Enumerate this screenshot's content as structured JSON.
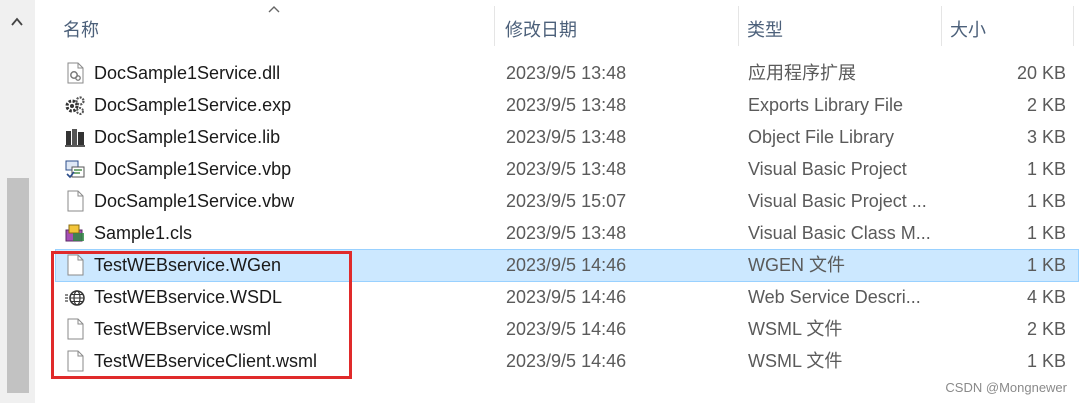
{
  "header": {
    "col_name": "名称",
    "col_date": "修改日期",
    "col_type": "类型",
    "col_size": "大小"
  },
  "files": [
    {
      "name": "DocSample1Service.dll",
      "date": "2023/9/5 13:48",
      "type": "应用程序扩展",
      "size": "20 KB",
      "icon": "dll-file-icon"
    },
    {
      "name": "DocSample1Service.exp",
      "date": "2023/9/5 13:48",
      "type": "Exports Library File",
      "size": "2 KB",
      "icon": "exp-file-icon"
    },
    {
      "name": "DocSample1Service.lib",
      "date": "2023/9/5 13:48",
      "type": "Object File Library",
      "size": "3 KB",
      "icon": "lib-file-icon"
    },
    {
      "name": "DocSample1Service.vbp",
      "date": "2023/9/5 13:48",
      "type": "Visual Basic Project",
      "size": "1 KB",
      "icon": "vb-project-icon"
    },
    {
      "name": "DocSample1Service.vbw",
      "date": "2023/9/5 15:07",
      "type": "Visual Basic Project ...",
      "size": "1 KB",
      "icon": "blank-file-icon"
    },
    {
      "name": "Sample1.cls",
      "date": "2023/9/5 13:48",
      "type": "Visual Basic Class M...",
      "size": "1 KB",
      "icon": "vb-class-icon"
    },
    {
      "name": "TestWEBservice.WGen",
      "date": "2023/9/5 14:46",
      "type": "WGEN 文件",
      "size": "1 KB",
      "icon": "blank-file-icon",
      "selected": true
    },
    {
      "name": "TestWEBservice.WSDL",
      "date": "2023/9/5 14:46",
      "type": "Web Service Descri...",
      "size": "4 KB",
      "icon": "web-service-icon"
    },
    {
      "name": "TestWEBservice.wsml",
      "date": "2023/9/5 14:46",
      "type": "WSML 文件",
      "size": "2 KB",
      "icon": "blank-file-icon"
    },
    {
      "name": "TestWEBserviceClient.wsml",
      "date": "2023/9/5 14:46",
      "type": "WSML 文件",
      "size": "1 KB",
      "icon": "blank-file-icon"
    }
  ],
  "watermark": "CSDN @Mongnewer",
  "colors": {
    "selected_bg": "#cce8ff",
    "highlight_border": "#e02a2a"
  }
}
